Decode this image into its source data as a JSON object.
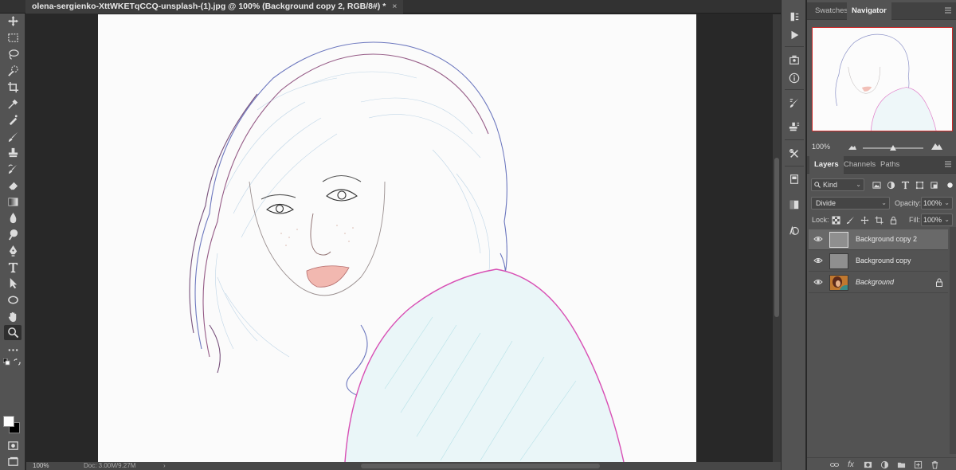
{
  "document": {
    "tab_title": "olena-sergienko-XttWKETqCCQ-unsplash-(1).jpg @ 100% (Background copy 2, RGB/8#) *",
    "close_glyph": "×"
  },
  "tools": [
    {
      "name": "move-tool",
      "icon": "move-icon"
    },
    {
      "name": "rectangular-marquee-tool",
      "icon": "marquee-icon"
    },
    {
      "name": "lasso-tool",
      "icon": "lasso-icon"
    },
    {
      "name": "quick-selection-tool",
      "icon": "quick-selection-icon"
    },
    {
      "name": "crop-tool",
      "icon": "crop-icon"
    },
    {
      "name": "eyedropper-tool",
      "icon": "eyedropper-icon"
    },
    {
      "name": "spot-healing-brush-tool",
      "icon": "healing-brush-icon"
    },
    {
      "name": "brush-tool",
      "icon": "brush-icon"
    },
    {
      "name": "clone-stamp-tool",
      "icon": "clone-stamp-icon"
    },
    {
      "name": "history-brush-tool",
      "icon": "history-brush-icon"
    },
    {
      "name": "eraser-tool",
      "icon": "eraser-icon"
    },
    {
      "name": "gradient-tool",
      "icon": "gradient-icon"
    },
    {
      "name": "blur-tool",
      "icon": "blur-icon"
    },
    {
      "name": "dodge-tool",
      "icon": "dodge-icon"
    },
    {
      "name": "pen-tool",
      "icon": "pen-icon"
    },
    {
      "name": "type-tool",
      "icon": "type-icon"
    },
    {
      "name": "path-selection-tool",
      "icon": "path-selection-icon"
    },
    {
      "name": "ellipse-tool",
      "icon": "ellipse-icon"
    },
    {
      "name": "hand-tool",
      "icon": "hand-icon"
    },
    {
      "name": "zoom-tool",
      "icon": "zoom-icon"
    },
    {
      "name": "edit-toolbar",
      "icon": "more-icon"
    }
  ],
  "status": {
    "zoom": "100%",
    "doc": "Doc: 3.00M/9.27M",
    "arrow": "›"
  },
  "navigator": {
    "tabs": [
      "Swatches",
      "Navigator"
    ],
    "active_tab": "Navigator",
    "zoom": "100%",
    "view_box_color": "#cc2a2a"
  },
  "layers": {
    "tabs": [
      "Layers",
      "Channels",
      "Paths"
    ],
    "active_tab": "Layers",
    "filter_kind": "Kind",
    "blend_mode": "Divide",
    "opacity_label": "Opacity:",
    "opacity_value": "100%",
    "lock_label": "Lock:",
    "fill_label": "Fill:",
    "fill_value": "100%",
    "caret": "⌄",
    "items": [
      {
        "name": "Background copy 2",
        "selected": true,
        "italic": false,
        "locked": false,
        "visible": true
      },
      {
        "name": "Background copy",
        "selected": false,
        "italic": false,
        "locked": false,
        "visible": true
      },
      {
        "name": "Background",
        "selected": false,
        "italic": true,
        "locked": true,
        "visible": true
      }
    ]
  },
  "layer_footer": {
    "fx_label": "fx"
  }
}
